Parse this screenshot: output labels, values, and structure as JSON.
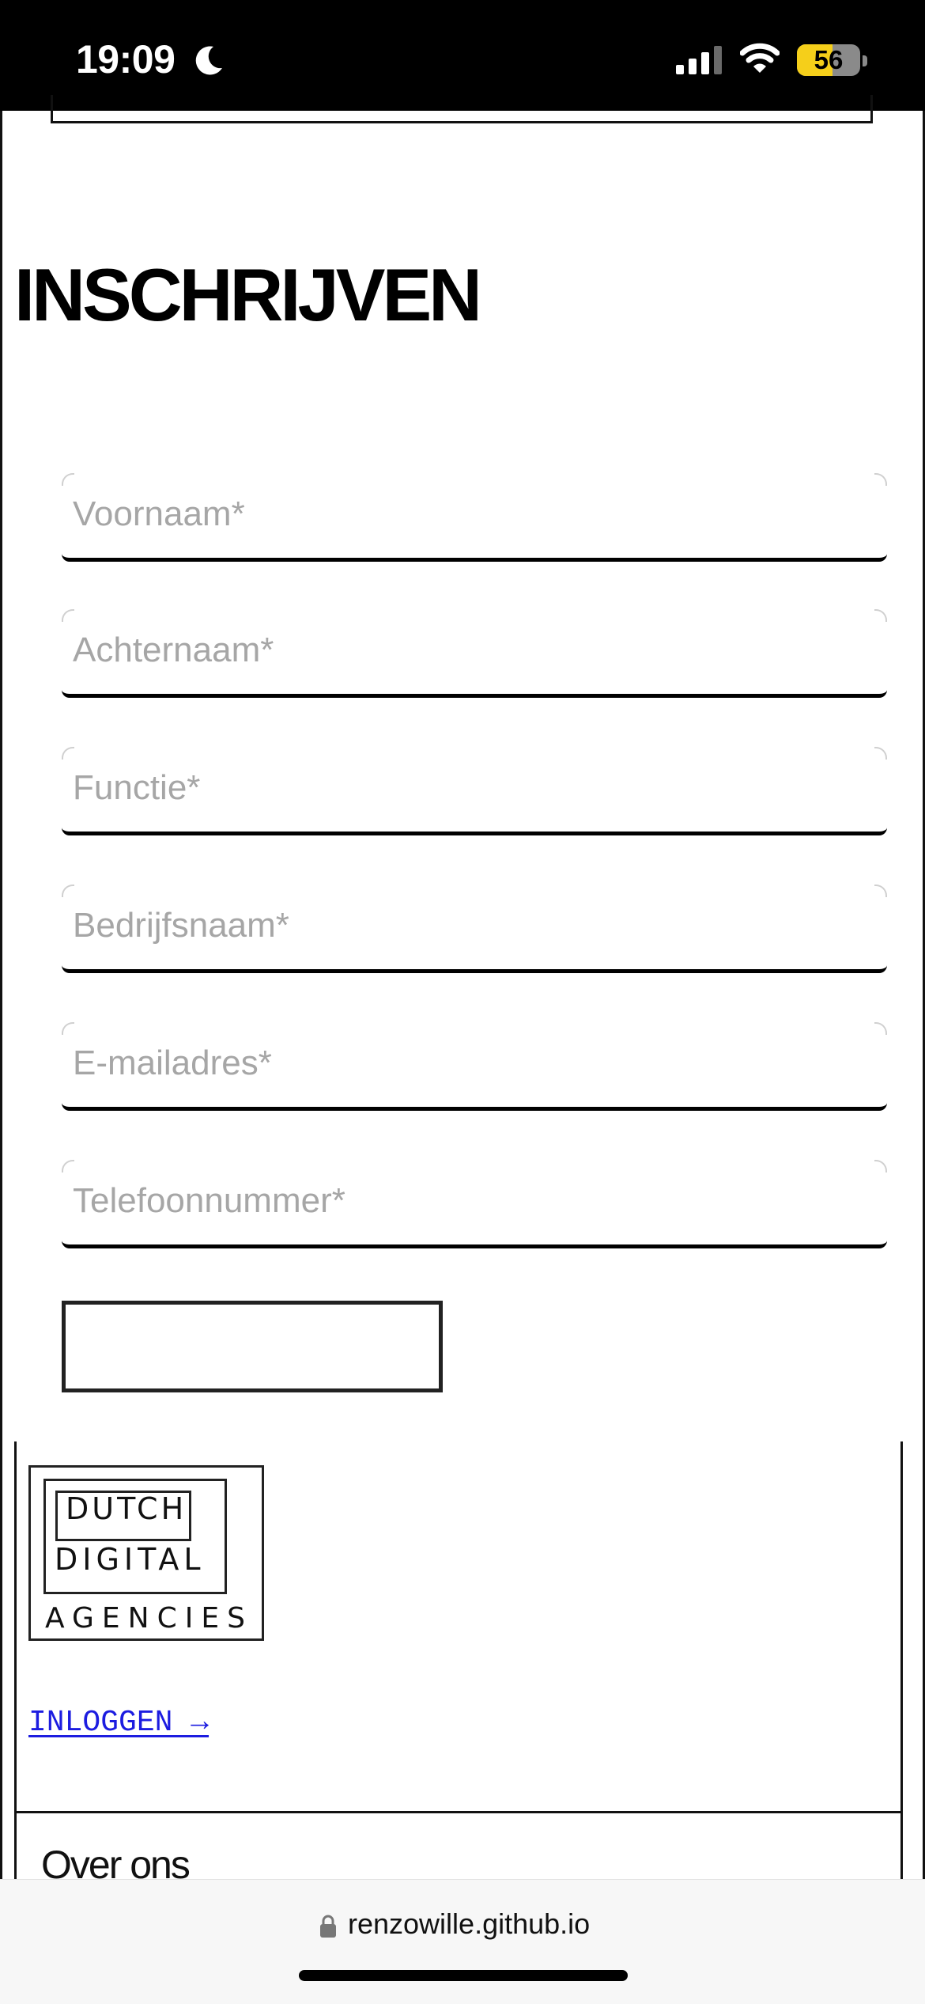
{
  "status_bar": {
    "time": "19:09",
    "battery": "56",
    "battery_level": 0.56,
    "icons": [
      "moon-icon",
      "cellular-signal-icon",
      "wifi-icon",
      "battery-icon"
    ]
  },
  "page": {
    "heading": "INSCHRIJVEN"
  },
  "form": {
    "fields": [
      {
        "placeholder": "Voornaam*",
        "value": ""
      },
      {
        "placeholder": "Achternaam*",
        "value": ""
      },
      {
        "placeholder": "Functie*",
        "value": ""
      },
      {
        "placeholder": "Bedrijfsnaam*",
        "value": ""
      },
      {
        "placeholder": "E-mailadres*",
        "value": ""
      },
      {
        "placeholder": "Telefoonnummer*",
        "value": ""
      }
    ]
  },
  "footer": {
    "logo": {
      "line1": "DUTCH",
      "line2": "DIGITAL",
      "line3": "AGENCIES"
    },
    "login_link": "INLOGGEN →",
    "section_title": "Over ons"
  },
  "browser": {
    "url": "renzowille.github.io",
    "icons": [
      "lock-icon"
    ]
  },
  "colors": {
    "link": "#1c1ce0",
    "placeholder": "#a6a6a6",
    "battery_fill": "#f5cf1a"
  }
}
